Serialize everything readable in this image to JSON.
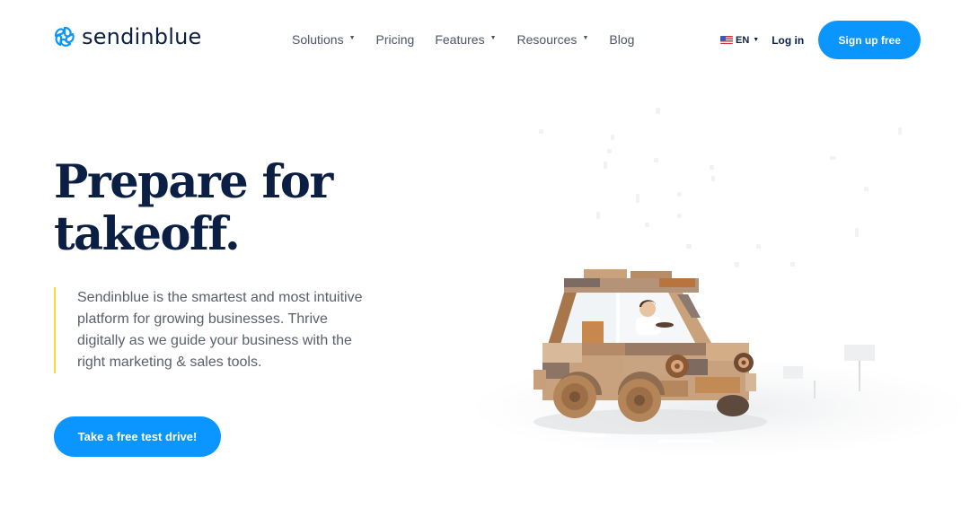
{
  "header": {
    "logo_text": "sendinblue",
    "nav": [
      {
        "label": "Solutions",
        "has_dropdown": true
      },
      {
        "label": "Pricing",
        "has_dropdown": false
      },
      {
        "label": "Features",
        "has_dropdown": true
      },
      {
        "label": "Resources",
        "has_dropdown": true
      },
      {
        "label": "Blog",
        "has_dropdown": false
      }
    ],
    "language": "EN",
    "language_flag": "us-flag-icon",
    "login_label": "Log in",
    "signup_label": "Sign up free",
    "caret_glyph": "▼"
  },
  "hero": {
    "headline_line1": "Prepare for",
    "headline_line2": "takeoff.",
    "description": "Sendinblue is the smartest and most intuitive platform for growing businesses. Thrive digitally as we guide your business with the right marketing & sales tools.",
    "cta_label": "Take a free test drive!",
    "illustration": "wooden-toy-car-with-driver"
  },
  "colors": {
    "brand_blue": "#0b96ff",
    "navy": "#0b1f44",
    "accent_yellow": "#ffd23f",
    "body_gray": "#5a606b"
  }
}
